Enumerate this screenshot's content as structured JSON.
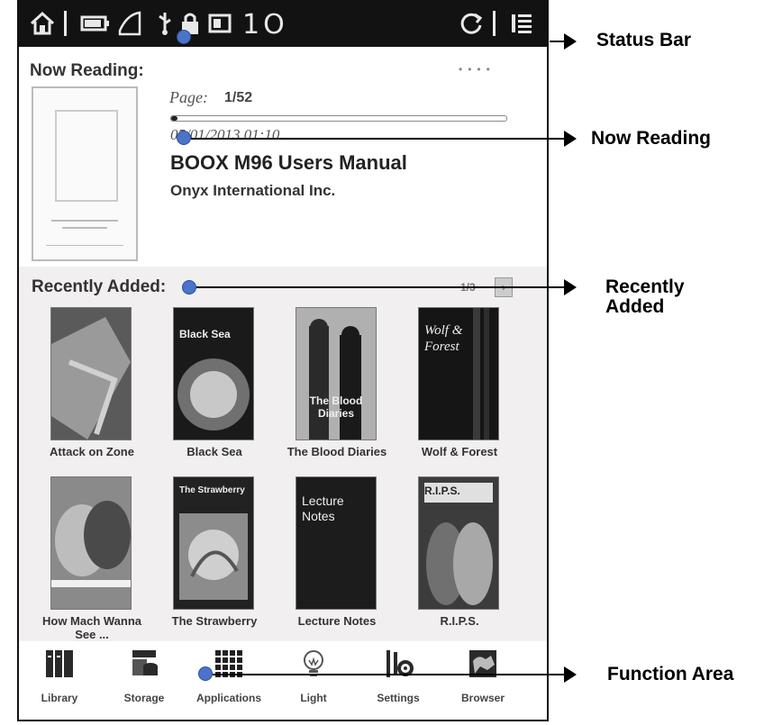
{
  "status_bar": {
    "time": "1O",
    "icons": [
      "home-icon",
      "battery-icon",
      "signal-icon",
      "usb-icon",
      "lock-icon",
      "sd-card-icon",
      "refresh-icon",
      "menu-icon"
    ]
  },
  "now_reading": {
    "title": "Now Reading:",
    "page_label": "Page:",
    "page_value": "1/52",
    "progress": 0.02,
    "date": "05/01/2013 01:10",
    "book_title": "BOOX M96 Users Manual",
    "author": "Onyx International Inc."
  },
  "recently_added": {
    "title": "Recently Added:",
    "pager": "1/3",
    "next_icon": "chevron-right-icon",
    "books": [
      {
        "label": "Attack on Zone",
        "cover_text": ""
      },
      {
        "label": "Black Sea",
        "cover_text": "Black Sea"
      },
      {
        "label": "The Blood Diaries",
        "cover_text": "The Blood Diaries"
      },
      {
        "label": "Wolf & Forest",
        "cover_text": "Wolf & Forest"
      },
      {
        "label": "How Mach Wanna See ...",
        "cover_text": ""
      },
      {
        "label": "The Strawberry",
        "cover_text": "The Strawberry"
      },
      {
        "label": "Lecture Notes",
        "cover_text": "Lecture Notes"
      },
      {
        "label": "R.I.P.S.",
        "cover_text": "R.I.P.S."
      }
    ]
  },
  "function_area": {
    "items": [
      {
        "label": "Library",
        "icon": "library-icon"
      },
      {
        "label": "Storage",
        "icon": "storage-icon"
      },
      {
        "label": "Applications",
        "icon": "applications-icon"
      },
      {
        "label": "Light",
        "icon": "light-bulb-icon"
      },
      {
        "label": "Settings",
        "icon": "settings-icon"
      },
      {
        "label": "Browser",
        "icon": "browser-icon"
      }
    ]
  },
  "callouts": {
    "status_bar": "Status Bar",
    "now_reading": "Now Reading",
    "recently_added_line1": "Recently",
    "recently_added_line2": "Added",
    "function_area": "Function Area"
  },
  "colors": {
    "callout_dot": "#4a74c9",
    "status_bar_bg": "#121212",
    "recent_bg": "#f1eff0"
  }
}
